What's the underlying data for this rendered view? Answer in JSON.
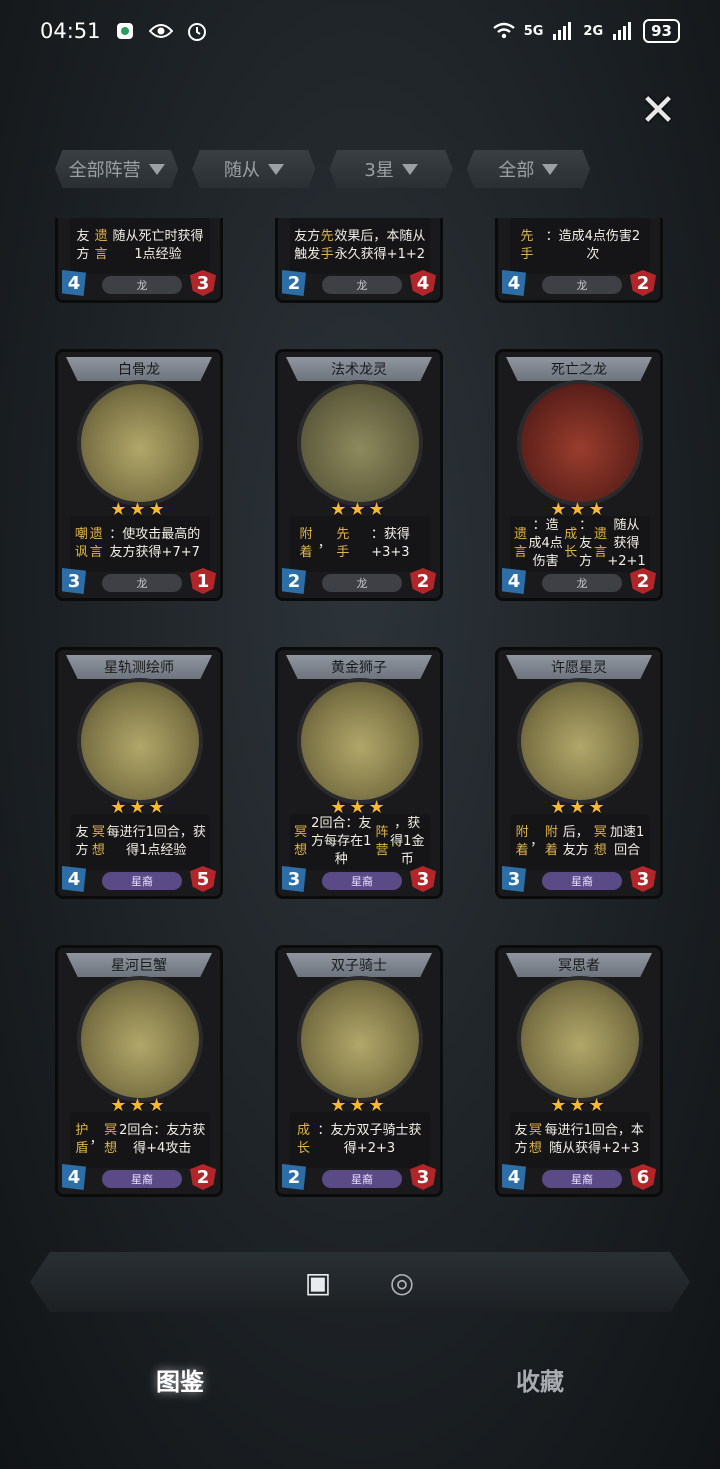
{
  "status_bar": {
    "time": "04:51",
    "network_1": "5G",
    "network_2": "2G",
    "battery": "93"
  },
  "filters": [
    {
      "label": "全部阵营"
    },
    {
      "label": "随从"
    },
    {
      "label": "3星"
    },
    {
      "label": "全部"
    }
  ],
  "cards": [
    {
      "name": "",
      "desc_html": "友方<span class='kw'>遗言</span>随从死亡时获得1点经验",
      "tribe": "龙",
      "cost": "4",
      "hp": "3",
      "stars": "★★★",
      "art": "red",
      "tribe_style": "dragon"
    },
    {
      "name": "",
      "desc_html": "友方触发<span class='kw'>先手</span>效果后，本随从永久获得+1+2",
      "tribe": "龙",
      "cost": "2",
      "hp": "4",
      "stars": "★★★",
      "art": "green",
      "tribe_style": "dragon"
    },
    {
      "name": "",
      "desc_html": "<span class='kw'>先手</span>：造成4点伤害2次",
      "tribe": "龙",
      "cost": "4",
      "hp": "2",
      "stars": "★★★",
      "art": "gold",
      "tribe_style": "dragon"
    },
    {
      "name": "白骨龙",
      "desc_html": "<span class='kw'>嘲讽</span><br><span class='kw'>遗言</span>：使攻击最高的友方获得+7+7",
      "tribe": "龙",
      "cost": "3",
      "hp": "1",
      "stars": "★★★",
      "art": "gold",
      "tribe_style": "dragon"
    },
    {
      "name": "法术龙灵",
      "desc_html": "<span class='kw'>附着</span>，<span class='kw'>先手</span>：获得+3+3",
      "tribe": "龙",
      "cost": "2",
      "hp": "2",
      "stars": "★★★",
      "art": "purple",
      "tribe_style": "dragon"
    },
    {
      "name": "死亡之龙",
      "desc_html": "<span class='kw'>遗言</span>：造成4点伤害<br><span class='kw'>成长</span>：友方<span class='kw'>遗言</span>随从获得+2+1",
      "tribe": "龙",
      "cost": "4",
      "hp": "2",
      "stars": "★★★",
      "art": "red",
      "tribe_style": "dragon"
    },
    {
      "name": "星轨测绘师",
      "desc_html": "友方<span class='kw'>冥想</span>每进行1回合，获得1点经验",
      "tribe": "星裔",
      "cost": "4",
      "hp": "5",
      "stars": "★★★",
      "art": "gold",
      "tribe_style": "star"
    },
    {
      "name": "黄金狮子",
      "desc_html": "<span class='kw'>冥想</span>2回合：友方每存在1种<span class='kw'>阵营</span>，获得1金币",
      "tribe": "星裔",
      "cost": "3",
      "hp": "3",
      "stars": "★★★",
      "art": "gold",
      "tribe_style": "star"
    },
    {
      "name": "许愿星灵",
      "desc_html": "<span class='kw'>附着</span>，<span class='kw'>附着</span>后，友方<span class='kw'>冥想</span>加速1回合",
      "tribe": "星裔",
      "cost": "3",
      "hp": "3",
      "stars": "★★★",
      "art": "gold",
      "tribe_style": "star"
    },
    {
      "name": "星河巨蟹",
      "desc_html": "<span class='kw'>护盾</span>，<span class='kw'>冥想</span>2回合：友方获得+4攻击",
      "tribe": "星裔",
      "cost": "4",
      "hp": "2",
      "stars": "★★★",
      "art": "gold",
      "tribe_style": "star"
    },
    {
      "name": "双子骑士",
      "desc_html": "<span class='kw'>成长</span>：友方双子骑士获得+2+3",
      "tribe": "星裔",
      "cost": "2",
      "hp": "3",
      "stars": "★★★",
      "art": "gold",
      "tribe_style": "star"
    },
    {
      "name": "冥思者",
      "desc_html": "友方<span class='kw'>冥想</span>每进行1回合，本随从获得+2+3",
      "tribe": "星裔",
      "cost": "4",
      "hp": "6",
      "stars": "★★★",
      "art": "gold",
      "tribe_style": "star"
    }
  ],
  "bottom_tabs": [
    {
      "icon": "cards-icon",
      "active": true
    },
    {
      "icon": "hero-icon",
      "active": false
    }
  ],
  "nav": {
    "codex": "图鉴",
    "collection": "收藏"
  }
}
